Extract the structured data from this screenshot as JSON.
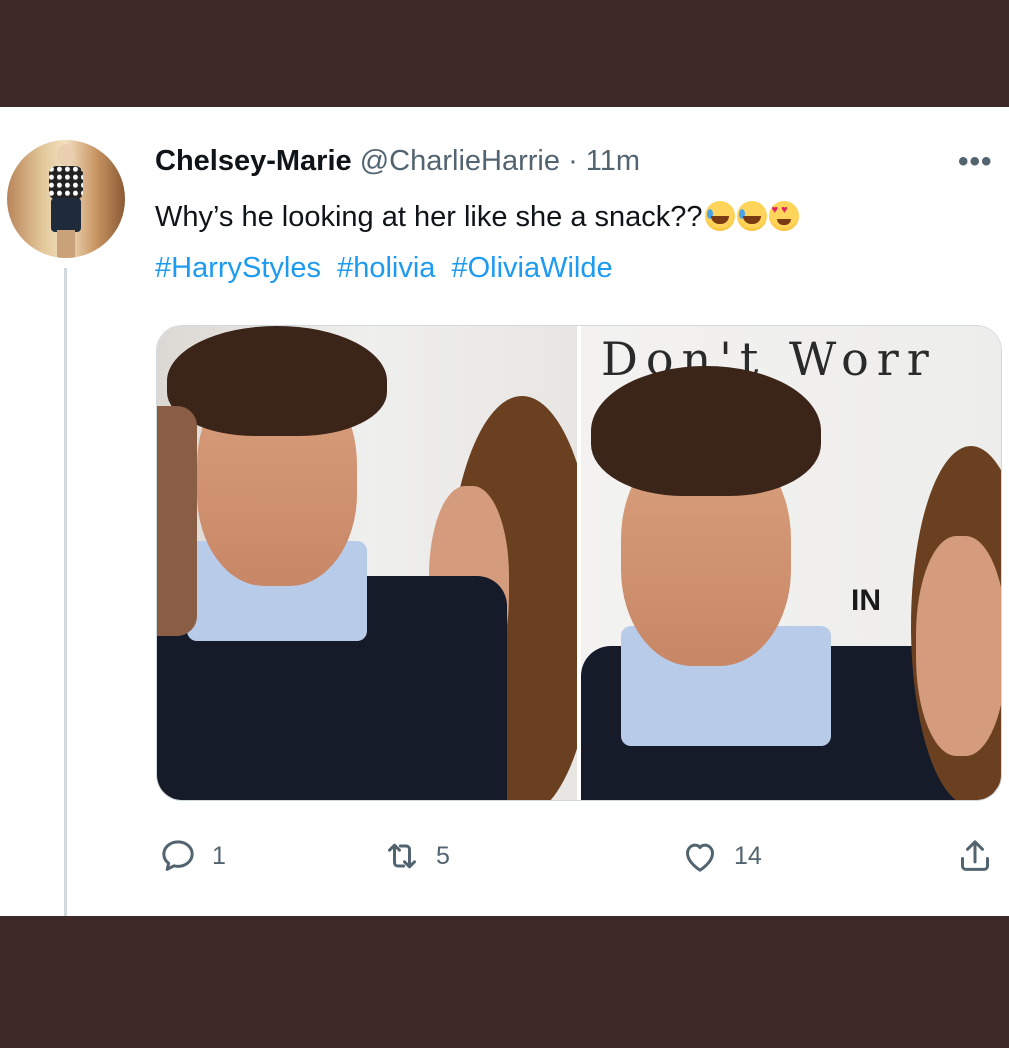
{
  "tweet": {
    "display_name": "Chelsey-Marie",
    "handle": "@CharlieHarrie",
    "separator": "·",
    "time": "11m",
    "more_label": "•••",
    "text": "Why’s he looking at her like she a snack??",
    "emojis": [
      "rolling-on-floor-laughing",
      "rolling-on-floor-laughing",
      "smiling-face-with-heart-eyes"
    ],
    "hashtags": [
      "#HarryStyles",
      "#holivia",
      "#OliviaWilde"
    ],
    "media": {
      "right_photo_sign_text": "Don't Worr",
      "right_photo_small_text": "IN"
    },
    "actions": {
      "replies": "1",
      "retweets": "5",
      "likes": "14"
    }
  },
  "colors": {
    "frame": "#3d2a28",
    "card": "#ffffff",
    "name": "#0f1419",
    "secondary": "#536471",
    "link": "#1d9bf0",
    "thread_line": "#cfd9de"
  },
  "icons": [
    "reply-icon",
    "retweet-icon",
    "like-icon",
    "share-icon",
    "more-icon"
  ]
}
